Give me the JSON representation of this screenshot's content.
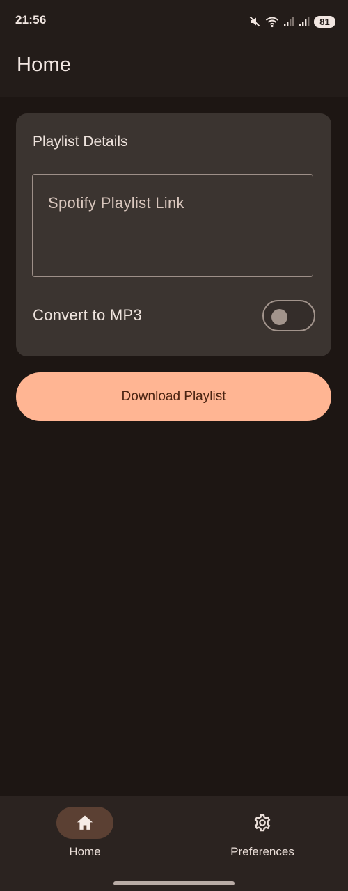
{
  "status_bar": {
    "time": "21:56",
    "battery": "81",
    "icons": [
      "mute-icon",
      "wifi-icon",
      "signal-icon",
      "signal-icon",
      "battery-icon"
    ]
  },
  "app_bar": {
    "title": "Home"
  },
  "playlist_card": {
    "title": "Playlist Details",
    "link_placeholder": "Spotify Playlist Link",
    "link_value": "",
    "convert_label": "Convert to MP3",
    "convert_enabled": false
  },
  "download_button": {
    "label": "Download Playlist"
  },
  "bottom_nav": {
    "items": [
      {
        "label": "Home",
        "icon": "home-icon",
        "selected": true
      },
      {
        "label": "Preferences",
        "icon": "gear-icon",
        "selected": false
      }
    ]
  },
  "colors": {
    "background": "#1d1613",
    "card": "#3b3430",
    "accent": "#ffb593",
    "nav_indicator": "#5b4033"
  }
}
